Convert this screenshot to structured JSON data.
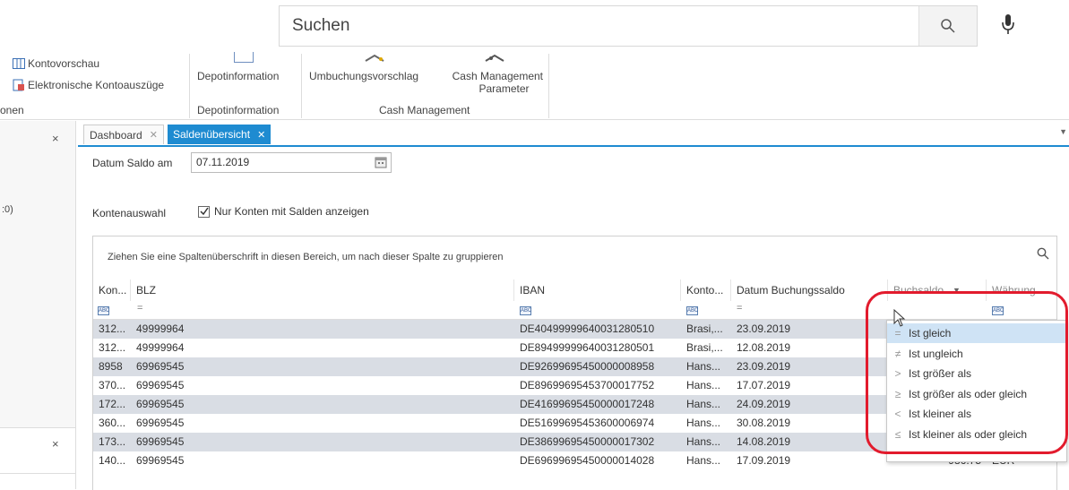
{
  "search": {
    "placeholder": "Suchen"
  },
  "ribbon": {
    "konto_vorschau": "Kontovorschau",
    "elektronische": "Elektronische Kontoauszüge",
    "left_group": "onen",
    "depotinformation": "Depotinformation",
    "depot_group": "Depotinformation",
    "umbuchung": "Umbuchungsvorschlag",
    "cash_param_line1": "Cash Management",
    "cash_param_line2": "Parameter",
    "cash_group": "Cash Management"
  },
  "leftpane": {
    "item": ":0)"
  },
  "tabs": [
    {
      "label": "Dashboard"
    },
    {
      "label": "Saldenübersicht"
    }
  ],
  "form": {
    "datum_label": "Datum Saldo am",
    "datum_value": "07.11.2019",
    "konten_label": "Kontenauswahl",
    "checkbox_label": "Nur Konten mit Salden anzeigen"
  },
  "grid": {
    "group_hint": "Ziehen Sie eine Spaltenüberschrift in diesen Bereich, um nach dieser Spalte zu gruppieren",
    "headers": [
      "Kon...",
      "BLZ",
      "IBAN",
      "Konto...",
      "Datum Buchungssaldo",
      "Buchsaldo",
      "Währung"
    ],
    "filter": {
      "abc": "ABC",
      "eq": "="
    },
    "rows": [
      {
        "kon": "312...",
        "blz": "49999964",
        "iban": "DE40499999640031280510",
        "konto": "Brasi,...",
        "datum": "23.09.2019"
      },
      {
        "kon": "312...",
        "blz": "49999964",
        "iban": "DE89499999640031280501",
        "konto": "Brasi,...",
        "datum": "12.08.2019"
      },
      {
        "kon": "8958",
        "blz": "69969545",
        "iban": "DE92699695450000008958",
        "konto": "Hans...",
        "datum": "23.09.2019"
      },
      {
        "kon": "370...",
        "blz": "69969545",
        "iban": "DE89699695453700017752",
        "konto": "Hans...",
        "datum": "17.07.2019"
      },
      {
        "kon": "172...",
        "blz": "69969545",
        "iban": "DE41699695450000017248",
        "konto": "Hans...",
        "datum": "24.09.2019"
      },
      {
        "kon": "360...",
        "blz": "69969545",
        "iban": "DE51699695453600006974",
        "konto": "Hans...",
        "datum": "30.08.2019"
      },
      {
        "kon": "173...",
        "blz": "69969545",
        "iban": "DE38699695450000017302",
        "konto": "Hans...",
        "datum": "14.08.2019"
      },
      {
        "kon": "140...",
        "blz": "69969545",
        "iban": "DE69699695450000014028",
        "konto": "Hans...",
        "datum": "17.09.2019",
        "saldo": "986.75",
        "waehrung": "EUR"
      }
    ]
  },
  "filter_menu": {
    "items": [
      {
        "symbol": "=",
        "label": "Ist gleich"
      },
      {
        "symbol": "≠",
        "label": "Ist ungleich"
      },
      {
        "symbol": ">",
        "label": "Ist größer als"
      },
      {
        "symbol": "≥",
        "label": "Ist größer als oder gleich"
      },
      {
        "symbol": "<",
        "label": "Ist kleiner als"
      },
      {
        "symbol": "≤",
        "label": "Ist kleiner als oder gleich"
      }
    ]
  },
  "colors": {
    "accent": "#1e8bd1",
    "highlight_ring": "#e21b2d",
    "selected_row": "#d9dde4",
    "menu_selected": "#cfe3f5"
  }
}
